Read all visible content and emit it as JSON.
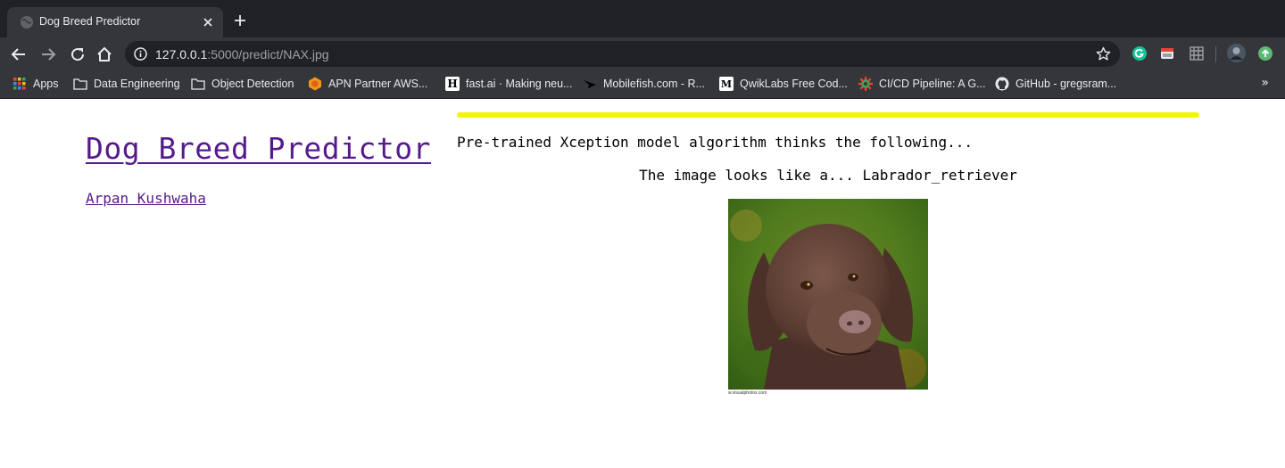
{
  "browser": {
    "tab_title": "Dog Breed Predictor",
    "url_host": "127.0.0.1",
    "url_rest": ":5000/predict/NAX.jpg",
    "bookmarks": [
      {
        "label": "Apps",
        "icon": "apps-grid-icon"
      },
      {
        "label": "Data Engineering",
        "icon": "folder-icon"
      },
      {
        "label": "Object Detection",
        "icon": "folder-icon"
      },
      {
        "label": "APN Partner AWS...",
        "icon": "aws-icon"
      },
      {
        "label": "fast.ai · Making neu...",
        "icon": "h-icon"
      },
      {
        "label": "Mobilefish.com - R...",
        "icon": "mobilefish-icon"
      },
      {
        "label": "QwikLabs Free Cod...",
        "icon": "m-icon"
      },
      {
        "label": "CI/CD Pipeline: A G...",
        "icon": "gear-colored-icon"
      },
      {
        "label": "GitHub - gregsram...",
        "icon": "github-icon"
      }
    ],
    "more_bookmarks": "»"
  },
  "page": {
    "title": "Dog Breed Predictor",
    "author": "Arpan Kushwaha",
    "intro": "Pre-trained Xception model algorithm thinks the following...",
    "result": "The image looks like a... Labrador_retriever",
    "image_watermark": "w.visualphotos.com"
  }
}
